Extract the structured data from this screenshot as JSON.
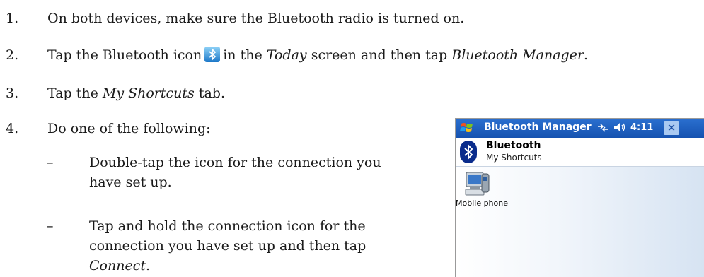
{
  "steps": [
    {
      "num": "1.",
      "text": "On both devices, make sure the Bluetooth radio is turned on."
    },
    {
      "num": "2.",
      "pre": "Tap the Bluetooth icon",
      "mid": "in the",
      "today": "Today",
      "post": "screen and then tap",
      "manager": "Bluetooth Manager",
      "end": "."
    },
    {
      "num": "3.",
      "pre": "Tap the",
      "em": "My Shortcuts",
      "post": "tab."
    },
    {
      "num": "4.",
      "text": "Do one of the following:"
    }
  ],
  "substeps": [
    {
      "dash": "–",
      "text": "Double-tap the icon for the connection you have set up."
    },
    {
      "dash": "–",
      "pre": "Tap and hold the connection icon for the connection you have set up and then tap",
      "em": "Connect",
      "end": "."
    }
  ],
  "device": {
    "title": "Bluetooth Manager",
    "time": "4:11",
    "close": "✕",
    "header_title": "Bluetooth",
    "header_subtitle": "My Shortcuts",
    "shortcut_label": "Mobile phone"
  },
  "icons": {
    "start": "windows-flag-icon",
    "connectivity": "connectivity-icon",
    "volume": "volume-icon",
    "bluetooth": "bluetooth-icon",
    "phone": "mobile-phone-icon"
  },
  "colors": {
    "titlebar": "#1552b0",
    "bluetooth_bg": "#0a2c8c"
  }
}
